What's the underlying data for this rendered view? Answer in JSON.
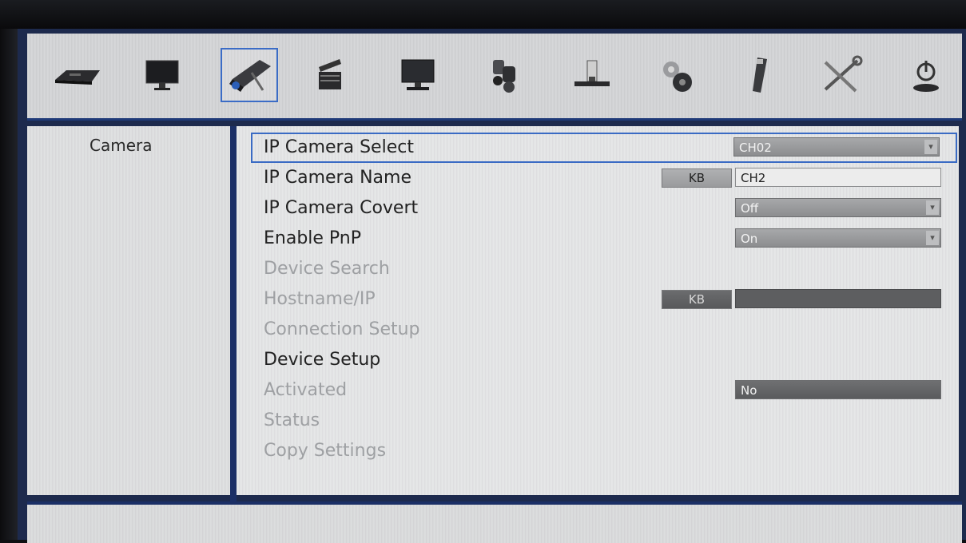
{
  "toolbar": {
    "icons": [
      {
        "name": "dvr-device-icon"
      },
      {
        "name": "monitor-icon"
      },
      {
        "name": "camera-icon",
        "selected": true
      },
      {
        "name": "clapper-record-icon"
      },
      {
        "name": "display-icon"
      },
      {
        "name": "ptz-camera-icon"
      },
      {
        "name": "storage-icon"
      },
      {
        "name": "gears-icon"
      },
      {
        "name": "usb-icon"
      },
      {
        "name": "tools-icon"
      },
      {
        "name": "power-icon"
      }
    ]
  },
  "left_panel": {
    "title": "Camera"
  },
  "settings": {
    "ip_camera_select": {
      "label": "IP Camera Select",
      "value": "CH02"
    },
    "ip_camera_name": {
      "label": "IP Camera Name",
      "kb": "KB",
      "value": "CH2"
    },
    "ip_camera_covert": {
      "label": "IP Camera Covert",
      "value": "Off"
    },
    "enable_pnp": {
      "label": "Enable PnP",
      "value": "On"
    },
    "device_search": {
      "label": "Device Search"
    },
    "hostname_ip": {
      "label": "Hostname/IP",
      "kb": "KB",
      "value": ""
    },
    "connection_setup": {
      "label": "Connection Setup"
    },
    "device_setup": {
      "label": "Device Setup"
    },
    "activated": {
      "label": "Activated",
      "value": "No"
    },
    "status": {
      "label": "Status"
    },
    "copy_settings": {
      "label": "Copy Settings"
    }
  },
  "colors": {
    "accent": "#3a6bc4",
    "frame": "#1b2f66"
  }
}
